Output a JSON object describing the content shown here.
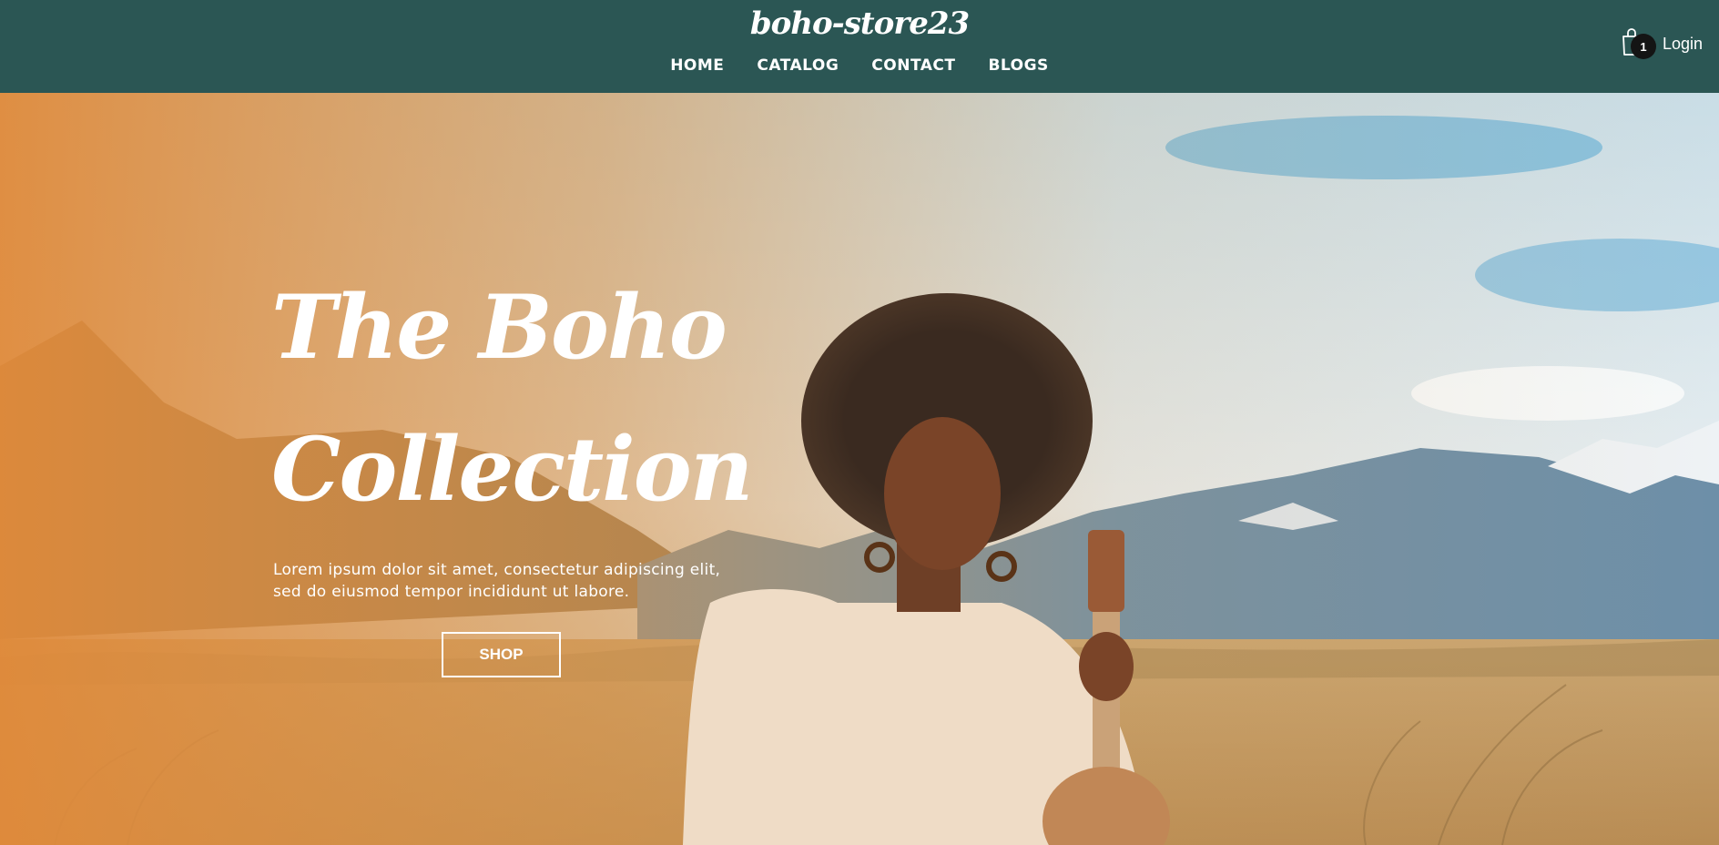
{
  "header": {
    "brand": "boho-store23",
    "nav": [
      "HOME",
      "CATALOG",
      "CONTACT",
      "BLOGS"
    ],
    "cart_icon": "shopping-bag-icon",
    "cart_count": "1",
    "login_label": "Login"
  },
  "hero": {
    "title_line1": "The Boho",
    "title_line2": "Collection",
    "text_line1": "Lorem ipsum dolor sit amet, consectetur adipiscing elit,",
    "text_line2": "sed do eiusmod tempor incididunt ut labore.",
    "button_label": "SHOP"
  },
  "colors": {
    "header_bg": "#2b5654",
    "overlay_warm": "#e08a3a",
    "sky_blue": "#5aa5cf",
    "badge_bg": "#141414"
  }
}
